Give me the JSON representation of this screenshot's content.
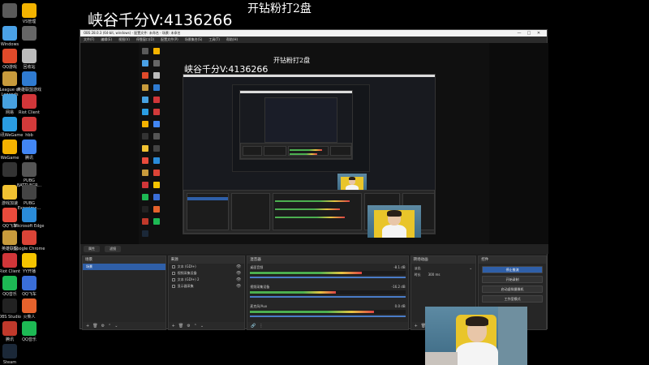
{
  "overlay": {
    "big_text": "峡谷千分V:4136266",
    "small_text": "开钻粉打2盘"
  },
  "desktop": {
    "icons": [
      {
        "label": "",
        "color": "#5a5a5a"
      },
      {
        "label": "VS管理",
        "color": "#f3b300"
      },
      {
        "label": "Windows",
        "color": "#4aa1e6"
      },
      {
        "label": "",
        "color": "#666"
      },
      {
        "label": "QQ游戏",
        "color": "#e04a2a"
      },
      {
        "label": "回收站",
        "color": "#bbb"
      },
      {
        "label": "League of Legends",
        "color": "#c89b3c"
      },
      {
        "label": "英雄联盟游戏",
        "color": "#2f7bd1"
      },
      {
        "label": "网易",
        "color": "#47a1e0"
      },
      {
        "label": "Riot Client",
        "color": "#d13639"
      },
      {
        "label": "腾讯WeGame",
        "color": "#2a9de2"
      },
      {
        "label": "hbb",
        "color": "#d23a3a"
      },
      {
        "label": "WeGame",
        "color": "#f4b200"
      },
      {
        "label": "腾讯",
        "color": "#4286f4"
      },
      {
        "label": "",
        "color": "#333"
      },
      {
        "label": "PUBG BATTLEGR...",
        "color": "#555"
      },
      {
        "label": "游戏加速",
        "color": "#f1c232"
      },
      {
        "label": "PUBG Experime...",
        "color": "#444"
      },
      {
        "label": "QQ飞车",
        "color": "#e94b3c"
      },
      {
        "label": "Microsoft Edge",
        "color": "#2a8bd8"
      },
      {
        "label": "英雄联盟",
        "color": "#c89b3c"
      },
      {
        "label": "Google Chrome",
        "color": "#db4437"
      },
      {
        "label": "Riot Client",
        "color": "#d13639"
      },
      {
        "label": "YY开播",
        "color": "#f5c400"
      },
      {
        "label": "QQ音乐",
        "color": "#1db954"
      },
      {
        "label": "QQ飞车",
        "color": "#3a6ed8"
      },
      {
        "label": "OBS Studio",
        "color": "#222"
      },
      {
        "label": "火柴人",
        "color": "#e6622c"
      },
      {
        "label": "腾讯",
        "color": "#c0392b"
      },
      {
        "label": "QQ音乐",
        "color": "#1db954"
      },
      {
        "label": "Steam",
        "color": "#1b2838"
      }
    ]
  },
  "obs": {
    "title": "OBS 28.0.3 (64-bit, windows) - 配置文件: 未命名 - 场景: 未命名",
    "window_buttons": [
      "—",
      "□",
      "✕"
    ],
    "menu": [
      "文件(F)",
      "编辑(E)",
      "视图(V)",
      "停靠窗口(D)",
      "配置文件(P)",
      "场景集合(S)",
      "工具(T)",
      "帮助(H)"
    ],
    "tabs": [
      "属性",
      "滤镜"
    ],
    "nested_overlay": {
      "big_text": "峡谷千分V:4136266",
      "small_text": "开钻粉打2盘"
    },
    "docks": {
      "scenes": {
        "title": "场景",
        "items": [
          "场景"
        ]
      },
      "sources": {
        "title": "来源",
        "items": [
          "文本 (GDI+)",
          "视频采集设备",
          "文本 (GDI+) 2",
          "显示器采集"
        ]
      },
      "mixer": {
        "title": "混音器",
        "channels": [
          {
            "name": "桌面音频",
            "db": "-8.1 dB",
            "level": 0.72
          },
          {
            "name": "视频采集设备",
            "db": "-16.2 dB",
            "level": 0.55
          },
          {
            "name": "麦克风/Aux",
            "db": "0.0 dB",
            "level": 0.8
          }
        ]
      },
      "transitions": {
        "title": "转场动画",
        "type": "淡出",
        "duration_label": "时长",
        "duration": "300 ms"
      },
      "controls": {
        "title": "控件",
        "buttons": [
          "停止推流",
          "开始录制",
          "启动虚拟摄像机",
          "工作室模式"
        ]
      }
    },
    "status": "LIVE 00:00:00  REC 00:00:00  CPU: 2.1%, 60.00 fps"
  },
  "colors": {
    "accent": "#2f5fa8",
    "panel": "#262626",
    "chair": "#e9c52a"
  }
}
